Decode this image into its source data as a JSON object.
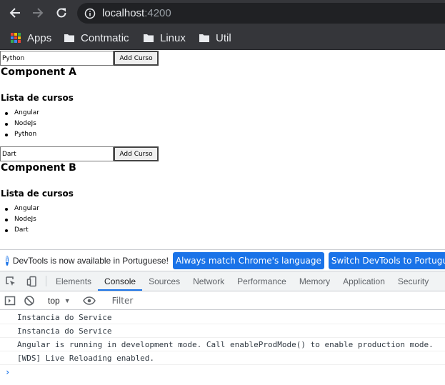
{
  "browser": {
    "url_host": "localhost",
    "url_port": ":4200",
    "bookmarks": [
      {
        "label": "Apps",
        "icon": "apps-grid-icon"
      },
      {
        "label": "Contmatic",
        "icon": "folder-icon"
      },
      {
        "label": "Linux",
        "icon": "folder-icon"
      },
      {
        "label": "Util",
        "icon": "folder-icon"
      }
    ]
  },
  "page": {
    "component_a": {
      "input_value": "Python",
      "button_label": "Add Curso",
      "title": "Component A",
      "list_title": "Lista de cursos",
      "courses": [
        "Angular",
        "NodeJs",
        "Python"
      ]
    },
    "component_b": {
      "input_value": "Dart",
      "button_label": "Add Curso",
      "title": "Component B",
      "list_title": "Lista de cursos",
      "courses": [
        "Angular",
        "NodeJs",
        "Dart"
      ]
    }
  },
  "devtools": {
    "infobar": {
      "message": "DevTools is now available in Portuguese!",
      "button_match": "Always match Chrome's language",
      "button_switch": "Switch DevTools to Portuguese"
    },
    "tabs": [
      "Elements",
      "Console",
      "Sources",
      "Network",
      "Performance",
      "Memory",
      "Application",
      "Security"
    ],
    "active_tab": "Console",
    "context": "top",
    "filter_placeholder": "Filter",
    "logs": [
      "Instancia do Service",
      "Instancia do Service",
      "Angular is running in development mode. Call enableProdMode() to enable production mode.",
      "[WDS] Live Reloading enabled."
    ],
    "prompt": "›"
  },
  "colors": {
    "chrome_dark": "#35363a",
    "accent_blue": "#1a73e8"
  }
}
